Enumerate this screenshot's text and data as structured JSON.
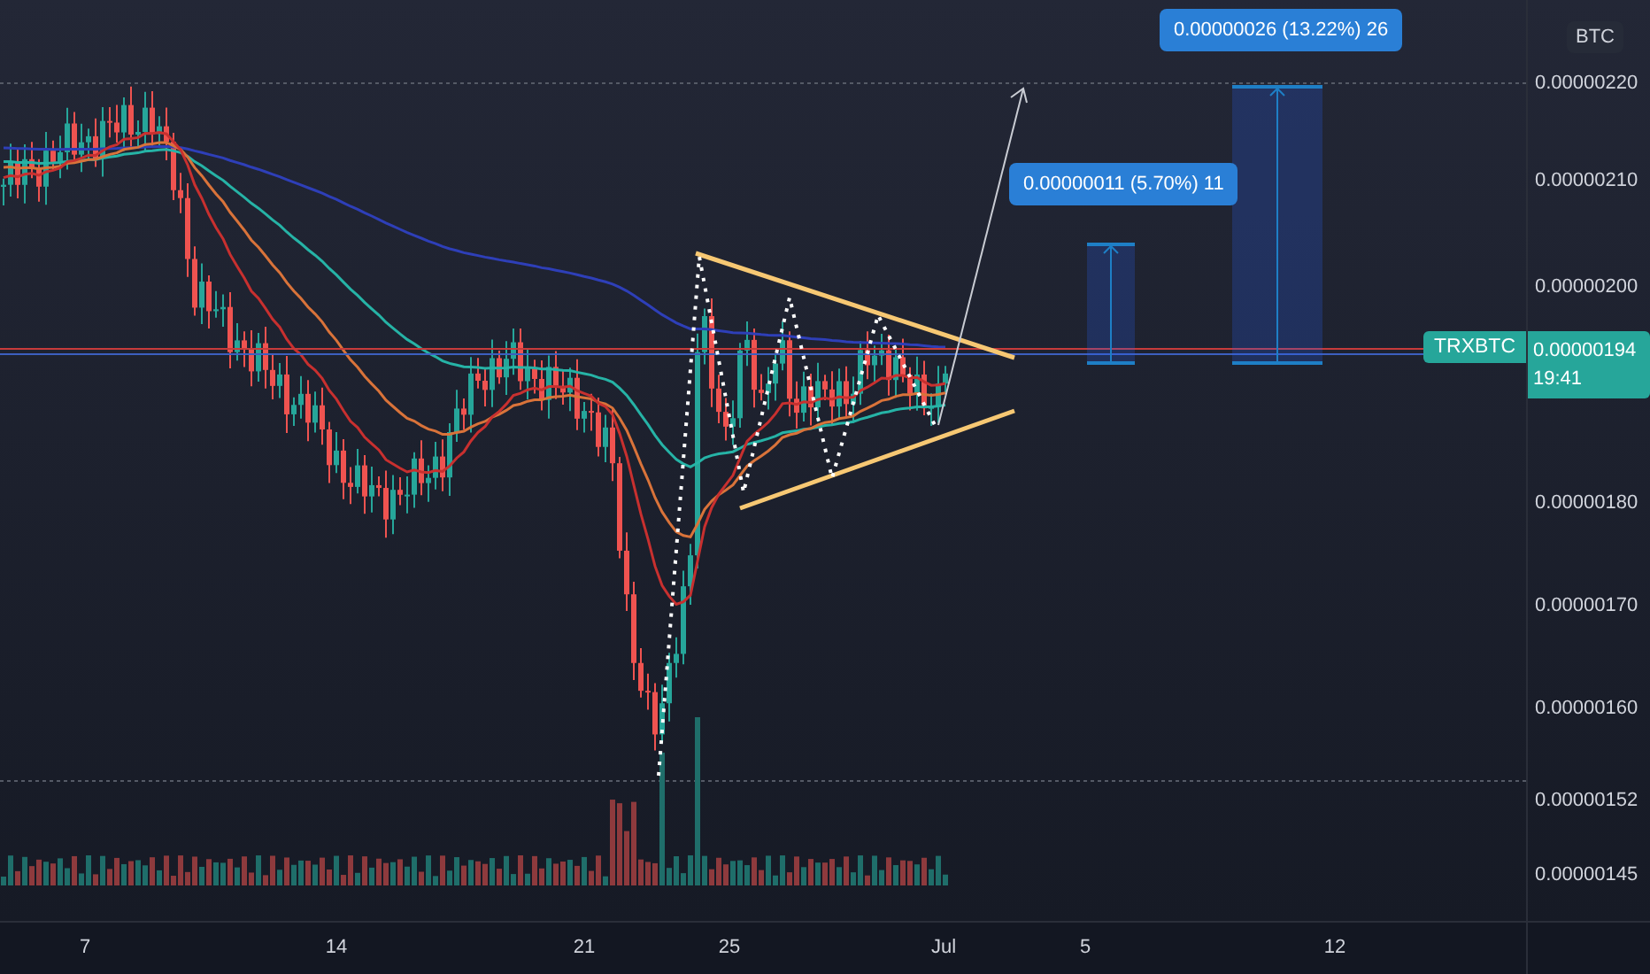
{
  "price_axis": {
    "currency": "BTC",
    "ticks": [
      "0.00000220",
      "0.00000210",
      "0.00000200",
      "0.00000180",
      "0.00000170",
      "0.00000160",
      "0.00000152",
      "0.00000145"
    ]
  },
  "time_axis": {
    "ticks": [
      "7",
      "14",
      "21",
      "25",
      "Jul",
      "5",
      "12"
    ]
  },
  "symbol_label": {
    "symbol": "TRXBTC",
    "price": "0.00000194",
    "countdown": "19:41"
  },
  "measurements": [
    {
      "text": "0.00000011 (5.70%) 11"
    },
    {
      "text": "0.00000026 (13.22%) 26"
    }
  ]
}
